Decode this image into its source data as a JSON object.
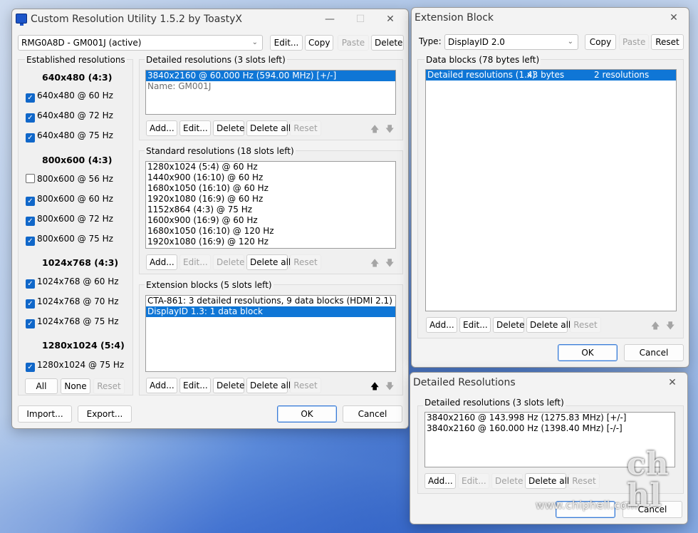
{
  "main_window": {
    "title": "Custom Resolution Utility 1.5.2 by ToastyX",
    "monitor_select": "RMG0A8D - GM001J (active)",
    "top_buttons": {
      "edit": "Edit...",
      "copy": "Copy",
      "paste": "Paste",
      "delete": "Delete"
    },
    "established": {
      "label": "Established resolutions",
      "groups": [
        {
          "header": "640x480 (4:3)",
          "items": [
            {
              "label": "640x480 @ 60 Hz",
              "checked": true
            },
            {
              "label": "640x480 @ 72 Hz",
              "checked": true
            },
            {
              "label": "640x480 @ 75 Hz",
              "checked": true
            }
          ]
        },
        {
          "header": "800x600 (4:3)",
          "items": [
            {
              "label": "800x600 @ 56 Hz",
              "checked": false
            },
            {
              "label": "800x600 @ 60 Hz",
              "checked": true
            },
            {
              "label": "800x600 @ 72 Hz",
              "checked": true
            },
            {
              "label": "800x600 @ 75 Hz",
              "checked": true
            }
          ]
        },
        {
          "header": "1024x768 (4:3)",
          "items": [
            {
              "label": "1024x768 @ 60 Hz",
              "checked": true
            },
            {
              "label": "1024x768 @ 70 Hz",
              "checked": true
            },
            {
              "label": "1024x768 @ 75 Hz",
              "checked": true
            }
          ]
        },
        {
          "header": "1280x1024 (5:4)",
          "items": [
            {
              "label": "1280x1024 @ 75 Hz",
              "checked": true
            }
          ]
        }
      ],
      "buttons": {
        "all": "All",
        "none": "None",
        "reset": "Reset"
      }
    },
    "detailed": {
      "label": "Detailed resolutions (3 slots left)",
      "items": [
        "3840x2160 @ 60.000 Hz (594.00 MHz) [+/-]",
        "Name: GM001J"
      ],
      "buttons": {
        "add": "Add...",
        "edit": "Edit...",
        "delete": "Delete",
        "delete_all": "Delete all",
        "reset": "Reset"
      }
    },
    "standard": {
      "label": "Standard resolutions (18 slots left)",
      "items": [
        "1280x1024 (5:4) @ 60 Hz",
        "1440x900 (16:10) @ 60 Hz",
        "1680x1050 (16:10) @ 60 Hz",
        "1920x1080 (16:9) @ 60 Hz",
        "1152x864 (4:3) @ 75 Hz",
        "1600x900 (16:9) @ 60 Hz",
        "1680x1050 (16:10) @ 120 Hz",
        "1920x1080 (16:9) @ 120 Hz"
      ],
      "buttons": {
        "add": "Add...",
        "edit": "Edit...",
        "delete": "Delete",
        "delete_all": "Delete all",
        "reset": "Reset"
      }
    },
    "extension": {
      "label": "Extension blocks (5 slots left)",
      "items": [
        "CTA-861: 3 detailed resolutions, 9 data blocks (HDMI 2.1)",
        "DisplayID 1.3: 1 data block"
      ],
      "buttons": {
        "add": "Add...",
        "edit": "Edit...",
        "delete": "Delete",
        "delete_all": "Delete all",
        "reset": "Reset"
      }
    },
    "bottom_buttons": {
      "import": "Import...",
      "export": "Export...",
      "ok": "OK",
      "cancel": "Cancel"
    }
  },
  "extension_window": {
    "title": "Extension Block",
    "type_label": "Type:",
    "type_value": "DisplayID 2.0",
    "buttons_top": {
      "copy": "Copy",
      "paste": "Paste",
      "reset": "Reset"
    },
    "data_blocks_label": "Data blocks (78 bytes left)",
    "row": {
      "name": "Detailed resolutions (1.x)",
      "size": "43 bytes",
      "count": "2 resolutions"
    },
    "buttons": {
      "add": "Add...",
      "edit": "Edit...",
      "delete": "Delete",
      "delete_all": "Delete all",
      "reset": "Reset"
    },
    "ok": "OK",
    "cancel": "Cancel"
  },
  "detailed_window": {
    "title": "Detailed Resolutions",
    "label": "Detailed resolutions (3 slots left)",
    "items": [
      "3840x2160 @ 143.998 Hz (1275.83 MHz) [+/-]",
      "3840x2160 @ 160.000 Hz (1398.40 MHz) [-/-]"
    ],
    "buttons": {
      "add": "Add...",
      "edit": "Edit...",
      "delete": "Delete",
      "delete_all": "Delete all",
      "reset": "Reset"
    },
    "cancel": "Cancel"
  },
  "watermark": {
    "url": "www.chiphell.com",
    "logo": "chip hell"
  }
}
